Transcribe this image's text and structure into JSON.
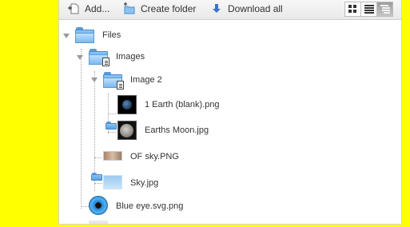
{
  "toolbar": {
    "add_label": "Add...",
    "create_folder_label": "Create folder",
    "download_all_label": "Download all",
    "icons": {
      "add": "add-file-icon",
      "create_folder": "new-folder-icon",
      "download_all": "download-arrow-icon",
      "view_grid": "grid-view-icon",
      "view_list": "list-view-icon",
      "view_tree": "tree-view-icon"
    },
    "active_view": "tree"
  },
  "tree": {
    "root": {
      "label": "Files",
      "icon": "folder-icon",
      "expanded": true
    },
    "images": {
      "label": "Images",
      "icon": "folder-with-doc-icon",
      "expanded": true
    },
    "image2": {
      "label": "Image 2",
      "icon": "folder-with-doc-icon",
      "expanded": true
    },
    "earth": {
      "label": "1 Earth (blank).png",
      "icon": "earth-thumbnail"
    },
    "moon": {
      "label": "Earths Moon.jpg",
      "icon": "moon-thumbnail"
    },
    "ofsky": {
      "label": "OF sky.PNG",
      "icon": "sky-thumbnail"
    },
    "sky": {
      "label": "Sky.jpg",
      "icon": "sky-folder-thumbnail"
    },
    "eye": {
      "label": "Blue eye.svg.png",
      "icon": "blue-eye-thumbnail"
    }
  },
  "colors": {
    "background": "#ffff00",
    "folder_blue": "#5aa2e2",
    "toolbar_bg": "#eeeeee"
  }
}
